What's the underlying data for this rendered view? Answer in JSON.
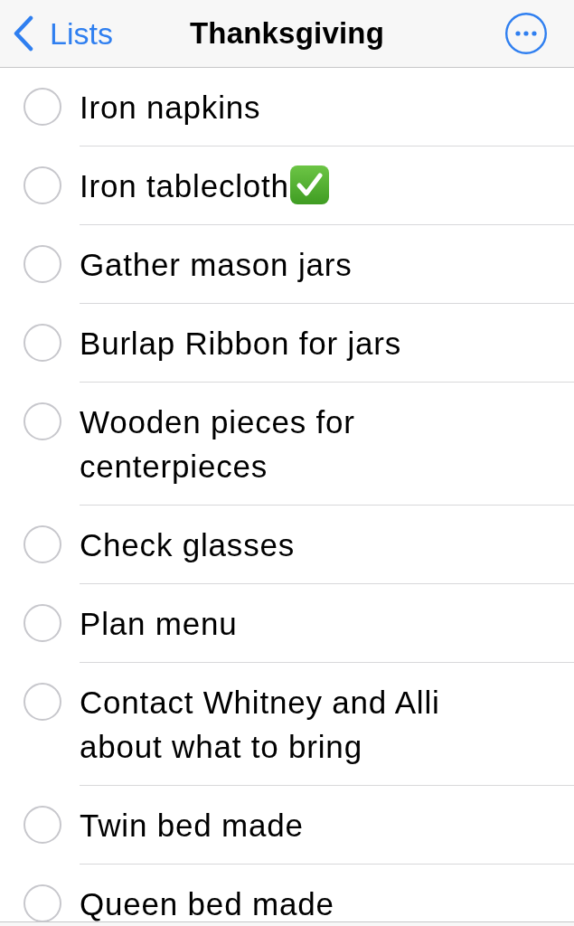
{
  "nav_bar": {
    "back_label": "Lists",
    "title": "Thanksgiving"
  },
  "reminders": [
    {
      "text": "Iron napkins",
      "completed": false,
      "check_emoji": false
    },
    {
      "text": "Iron tablecloth",
      "completed": false,
      "check_emoji": true
    },
    {
      "text": "Gather mason jars",
      "completed": false,
      "check_emoji": false
    },
    {
      "text": "Burlap Ribbon for jars",
      "completed": false,
      "check_emoji": false
    },
    {
      "text": "Wooden pieces for centerpieces",
      "completed": false,
      "check_emoji": false
    },
    {
      "text": "Check glasses",
      "completed": false,
      "check_emoji": false
    },
    {
      "text": "Plan menu",
      "completed": false,
      "check_emoji": false
    },
    {
      "text": "Contact Whitney and Alli about what to bring",
      "completed": false,
      "check_emoji": false
    },
    {
      "text": "Twin bed made",
      "completed": false,
      "check_emoji": false
    },
    {
      "text": "Queen bed made",
      "completed": false,
      "check_emoji": false
    }
  ]
}
